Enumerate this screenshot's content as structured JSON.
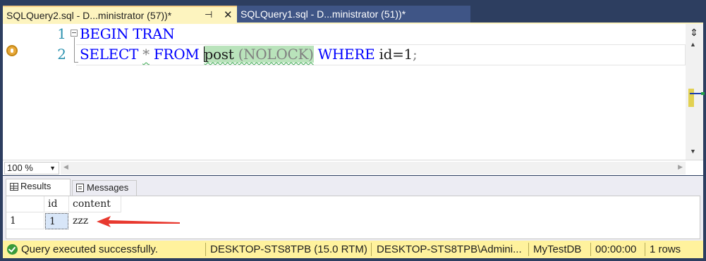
{
  "tabs": [
    {
      "title": "SQLQuery2.sql - D...ministrator (57))*",
      "active": true,
      "pin_icon": "pin-icon",
      "close_icon": "close-icon"
    },
    {
      "title": "SQLQuery1.sql - D...ministrator (51))*",
      "active": false
    }
  ],
  "editor": {
    "line_numbers": [
      "1",
      "2"
    ],
    "line1": {
      "kw1": "BEGIN",
      "kw2": "TRAN"
    },
    "line2": {
      "select": "SELECT",
      "star": "*",
      "from": "FROM",
      "table": "post",
      "hint": "(NOLOCK)",
      "where": "WHERE",
      "condition": "id=1",
      "semicolon": ";"
    }
  },
  "zoom": {
    "value": "100 %"
  },
  "results_tabs": {
    "results": "Results",
    "messages": "Messages"
  },
  "results_grid": {
    "columns": [
      "id",
      "content"
    ],
    "rows": [
      {
        "rownum": "1",
        "id": "1",
        "content": "zzz"
      }
    ],
    "annotation_color": "#e8392f"
  },
  "status": {
    "message": "Query executed successfully.",
    "server": "DESKTOP-STS8TPB (15.0 RTM)",
    "user": "DESKTOP-STS8TPB\\Admini...",
    "database": "MyTestDB",
    "elapsed": "00:00:00",
    "rows": "1 rows",
    "bar_color": "#fff29d"
  }
}
